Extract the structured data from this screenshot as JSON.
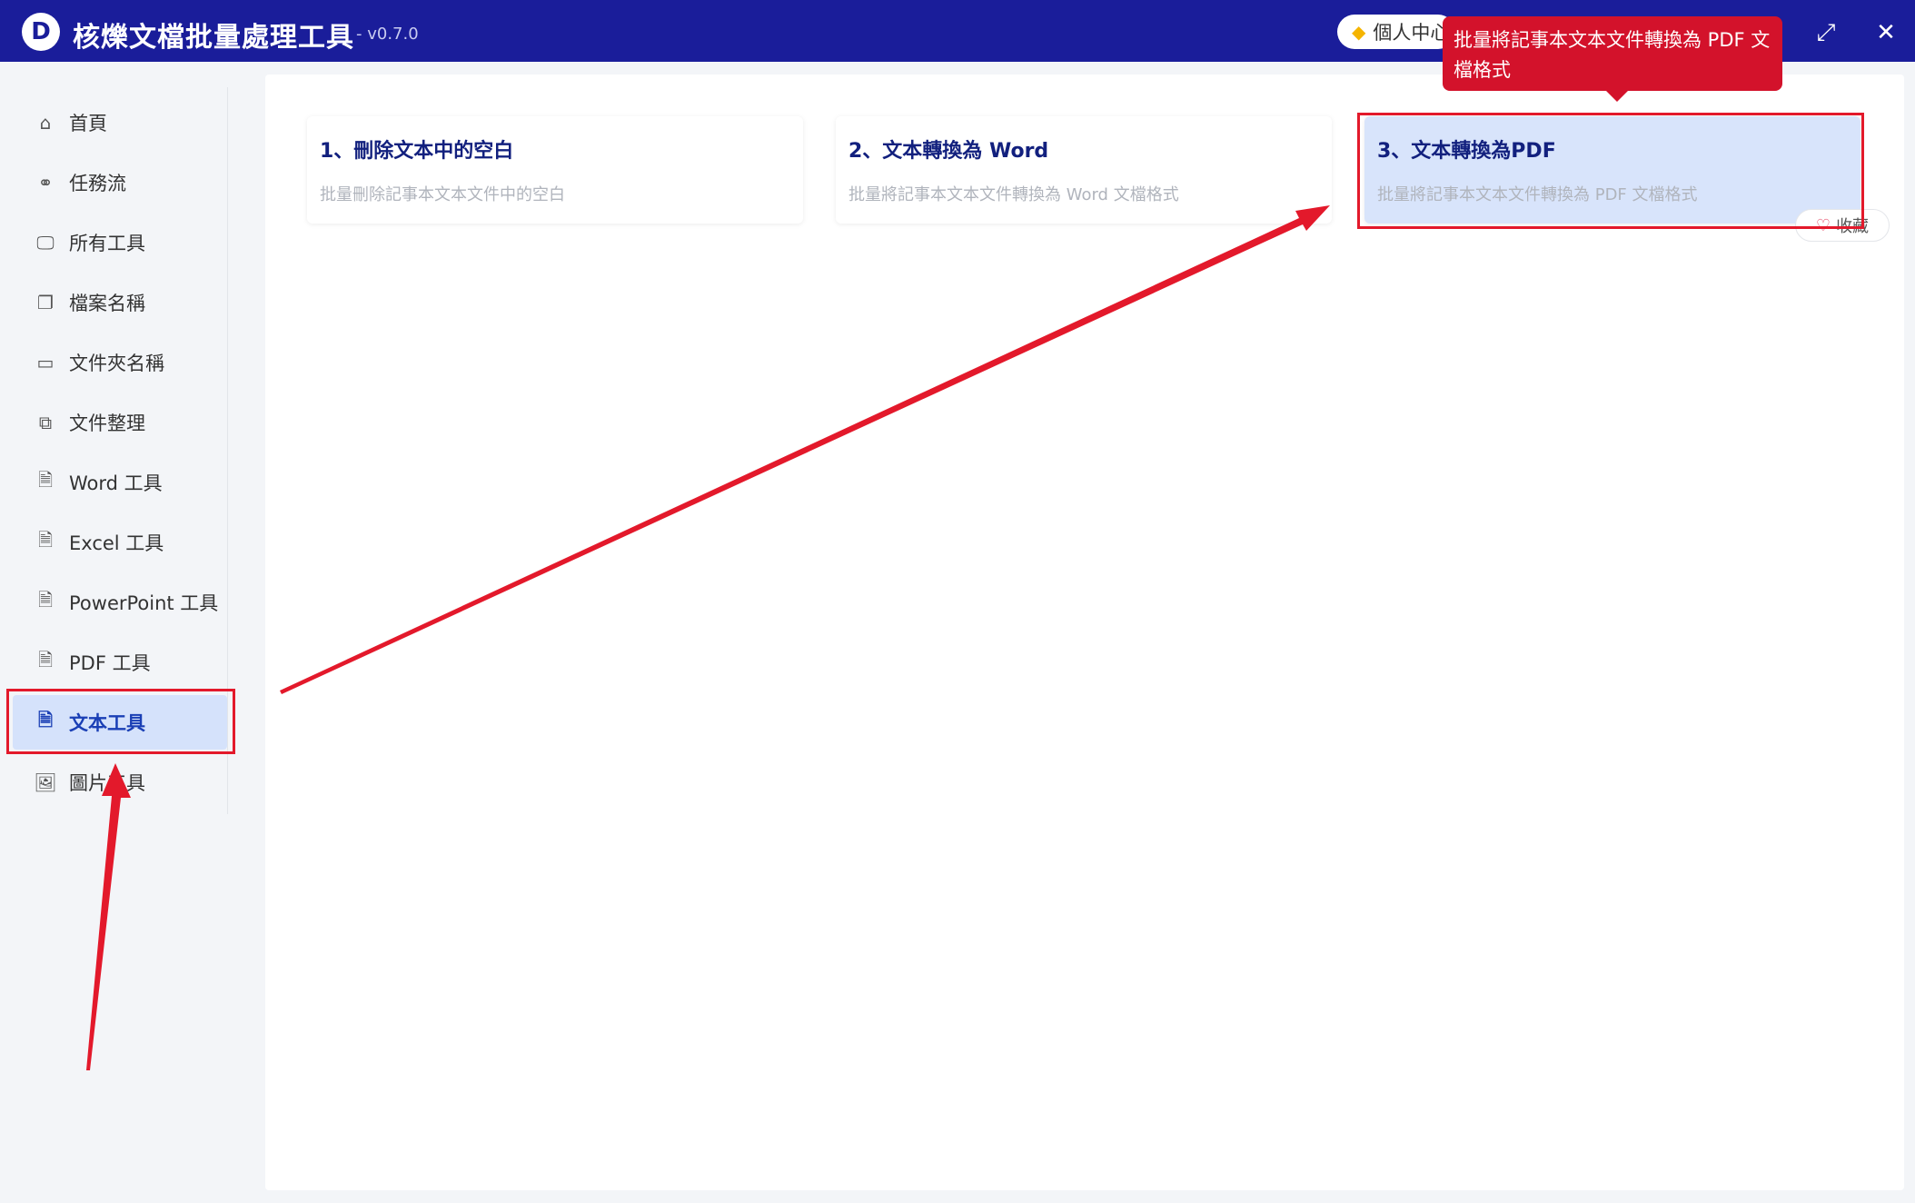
{
  "app": {
    "logo_letter": "D",
    "title": "核爍文檔批量處理工具",
    "version": "- v0.7.0",
    "user_center": "個人中心",
    "maximize_symbol": "⤢",
    "close_symbol": "✕"
  },
  "tooltip": {
    "text": "批量將記事本文本文件轉換為 PDF 文檔格式"
  },
  "sidebar": {
    "items": [
      {
        "label": "首頁",
        "icon": "home-icon",
        "glyph": "⌂"
      },
      {
        "label": "任務流",
        "icon": "workflow-icon",
        "glyph": "⚭"
      },
      {
        "label": "所有工具",
        "icon": "monitor-icon",
        "glyph": "🖵"
      },
      {
        "label": "檔案名稱",
        "icon": "files-icon",
        "glyph": "❐"
      },
      {
        "label": "文件夾名稱",
        "icon": "folder-icon",
        "glyph": "▭"
      },
      {
        "label": "文件整理",
        "icon": "organize-icon",
        "glyph": "⧉"
      },
      {
        "label": "Word 工具",
        "icon": "word-file-icon",
        "glyph": "🗎"
      },
      {
        "label": "Excel 工具",
        "icon": "excel-file-icon",
        "glyph": "🗎"
      },
      {
        "label": "PowerPoint 工具",
        "icon": "ppt-file-icon",
        "glyph": "🗎"
      },
      {
        "label": "PDF 工具",
        "icon": "pdf-file-icon",
        "glyph": "🗎"
      },
      {
        "label": "文本工具",
        "icon": "text-file-icon",
        "glyph": "🗎",
        "active": true
      },
      {
        "label": "圖片工具",
        "icon": "image-icon",
        "glyph": "🖼"
      }
    ]
  },
  "cards": [
    {
      "title": "1、刪除文本中的空白",
      "desc": "批量刪除記事本文本文件中的空白"
    },
    {
      "title": "2、文本轉換為 Word",
      "desc": "批量將記事本文本文件轉換為 Word 文檔格式"
    },
    {
      "title": "3、文本轉換為PDF",
      "desc": "批量將記事本文本文件轉換為 PDF 文檔格式"
    }
  ],
  "favorite": {
    "label": "收藏",
    "glyph": "♡"
  },
  "colors": {
    "titlebar": "#1a1d9a",
    "annotation": "#e3192b",
    "tooltip": "#d3122b",
    "active_nav": "#d5e2fb"
  }
}
